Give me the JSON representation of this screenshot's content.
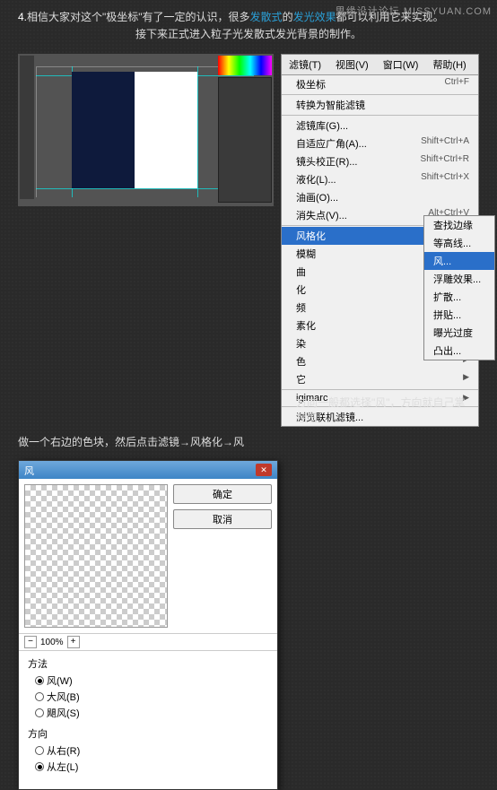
{
  "watermark": "思缘设计论坛 MISSYUAN.COM",
  "intro": {
    "prefix": "4.",
    "line1a": "相信大家对这个\"极坐标\"有了一定的认识，很多",
    "hl1": "发散式",
    "line1b": "的",
    "hl2": "发光效果",
    "line1c": "都可以利用它来实现。",
    "line2": "接下来正式进入粒子光发散式发光背景的制作。"
  },
  "menubar": {
    "filter": "滤镜(T)",
    "view": "视图(V)",
    "window": "窗口(W)",
    "help": "帮助(H)"
  },
  "menu": {
    "polar": "极坐标",
    "polar_sc": "Ctrl+F",
    "smart": "转换为智能滤镜",
    "gallery": "滤镜库(G)...",
    "wide": "自适应广角(A)...",
    "wide_sc": "Shift+Ctrl+A",
    "lens": "镜头校正(R)...",
    "lens_sc": "Shift+Ctrl+R",
    "liquify": "液化(L)...",
    "liquify_sc": "Shift+Ctrl+X",
    "oil": "油画(O)...",
    "vanish": "消失点(V)...",
    "vanish_sc": "Alt+Ctrl+V",
    "stylize": "风格化",
    "blur": "模糊",
    "distort": "曲",
    "sharpen": "化",
    "video": "频",
    "pixelate": "素化",
    "render": "染",
    "noise": "色",
    "other": "它",
    "digimarc": "igimarc",
    "browse": "浏览联机滤镜..."
  },
  "submenu": {
    "find": "查找边缘",
    "contour": "等高线...",
    "wind": "风...",
    "emboss": "浮雕效果...",
    "diffuse": "扩散...",
    "tiles": "拼贴...",
    "solarize": "曝光过度",
    "extrude": "凸出..."
  },
  "caption": {
    "a": "做一个右边的色块，然后点击",
    "b": "滤镜→风格化→风"
  },
  "dialog": {
    "title": "风",
    "ok": "确定",
    "cancel": "取消",
    "zoom": "100%",
    "method_label": "方法",
    "m1": "风(W)",
    "m2": "大风(B)",
    "m3": "飓风(S)",
    "dir_label": "方向",
    "d1": "从右(R)",
    "d2": "从左(L)"
  },
  "note": "方向一般都选择\"风\"，方向就自己掌控吧"
}
